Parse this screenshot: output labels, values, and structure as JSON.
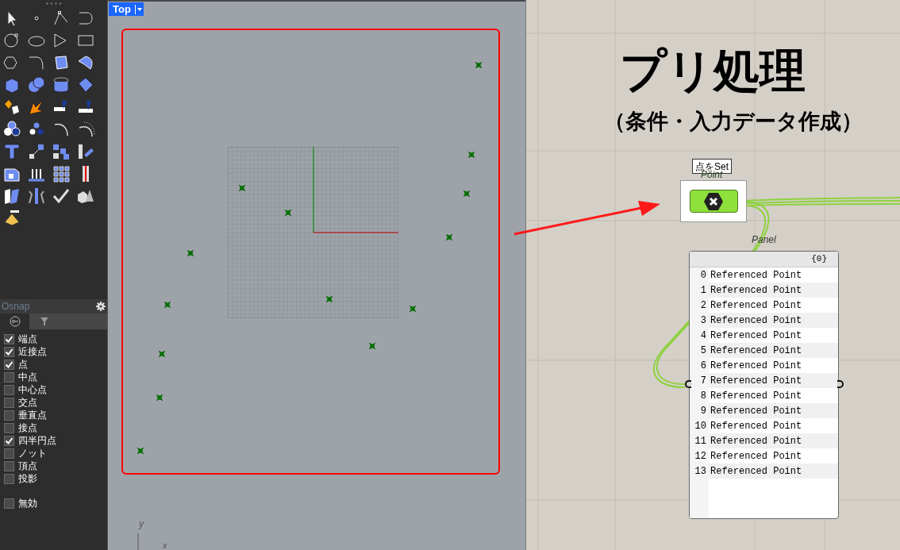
{
  "osnap": {
    "title": "Osnap",
    "items": [
      {
        "label": "端点",
        "checked": true
      },
      {
        "label": "近接点",
        "checked": true
      },
      {
        "label": "点",
        "checked": true
      },
      {
        "label": "中点",
        "checked": false
      },
      {
        "label": "中心点",
        "checked": false
      },
      {
        "label": "交点",
        "checked": false
      },
      {
        "label": "垂直点",
        "checked": false
      },
      {
        "label": "接点",
        "checked": false
      },
      {
        "label": "四半円点",
        "checked": true
      },
      {
        "label": "ノット",
        "checked": false
      },
      {
        "label": "頂点",
        "checked": false
      },
      {
        "label": "投影",
        "checked": false
      }
    ],
    "disable": {
      "label": "無効",
      "checked": false
    }
  },
  "viewport": {
    "name": "Top",
    "axis_y": "y",
    "axis_x": "x"
  },
  "canvas": {
    "title": "プリ処理",
    "subtitle": "（条件・入力データ作成）",
    "component": {
      "tooltip": "点をSet",
      "name": "Point"
    },
    "panel": {
      "name": "Panel",
      "path": "{0}",
      "rows": [
        {
          "index": "0",
          "value": "Referenced Point"
        },
        {
          "index": "1",
          "value": "Referenced Point"
        },
        {
          "index": "2",
          "value": "Referenced Point"
        },
        {
          "index": "3",
          "value": "Referenced Point"
        },
        {
          "index": "4",
          "value": "Referenced Point"
        },
        {
          "index": "5",
          "value": "Referenced Point"
        },
        {
          "index": "6",
          "value": "Referenced Point"
        },
        {
          "index": "7",
          "value": "Referenced Point"
        },
        {
          "index": "8",
          "value": "Referenced Point"
        },
        {
          "index": "9",
          "value": "Referenced Point"
        },
        {
          "index": "10",
          "value": "Referenced Point"
        },
        {
          "index": "11",
          "value": "Referenced Point"
        },
        {
          "index": "12",
          "value": "Referenced Point"
        },
        {
          "index": "13",
          "value": "Referenced Point"
        }
      ]
    }
  }
}
